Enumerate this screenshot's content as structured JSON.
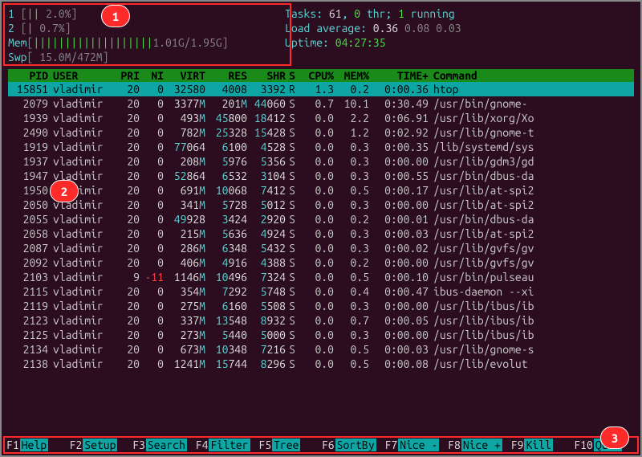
{
  "annotations": {
    "b1": "1",
    "b2": "2",
    "b3": "3"
  },
  "meters": {
    "cpu1": {
      "label": "1",
      "bar": "||",
      "pct": "2.0%"
    },
    "cpu2": {
      "label": "2",
      "bar": "|",
      "pct": "0.7%"
    },
    "mem": {
      "label": "Mem",
      "bar": "|||||||||||||||||||",
      "val": "1.01G/1.95G"
    },
    "swp": {
      "label": "Swp",
      "bar": "",
      "val": "15.0M/472M"
    }
  },
  "summary": {
    "tasks_lbl": "Tasks: ",
    "tasks": "61",
    "tasks_sep": ", ",
    "thr": "0",
    "thr_lbl": " thr; ",
    "running": "1",
    "running_lbl": " running",
    "la_lbl": "Load average: ",
    "la1": "0.36",
    "la2": "0.08",
    "la3": "0.03",
    "up_lbl": "Uptime: ",
    "up": "04:27:35"
  },
  "cols": {
    "pid": "PID",
    "user": "USER",
    "pri": "PRI",
    "ni": "NI",
    "virt": "VIRT",
    "res": "RES",
    "shr": "SHR",
    "s": "S",
    "cpu": "CPU%",
    "mem": "MEM%",
    "time": "TIME+",
    "cmd": "Command"
  },
  "rows": [
    {
      "pid": "15851",
      "user": "vladimir",
      "pri": "20",
      "ni": "0",
      "virt": "32580",
      "res": "4008",
      "shr": "3392",
      "s": "R",
      "cpu": "1.3",
      "mem": "0.2",
      "time": "0:00.36",
      "cmd": "htop",
      "sel": true
    },
    {
      "pid": "2079",
      "user": "vladimir",
      "pri": "20",
      "ni": "0",
      "virt": "3377M",
      "res": "201M",
      "shr": "44060",
      "s": "S",
      "cpu": "0.7",
      "mem": "10.1",
      "time": "0:30.49",
      "cmd": "/usr/bin/gnome-"
    },
    {
      "pid": "1939",
      "user": "vladimir",
      "pri": "20",
      "ni": "0",
      "virt": "493M",
      "res": "45800",
      "shr": "18412",
      "s": "S",
      "cpu": "0.0",
      "mem": "2.2",
      "time": "0:06.91",
      "cmd": "/usr/lib/xorg/Xo"
    },
    {
      "pid": "2490",
      "user": "vladimir",
      "pri": "20",
      "ni": "0",
      "virt": "782M",
      "res": "25328",
      "shr": "15428",
      "s": "S",
      "cpu": "0.0",
      "mem": "1.2",
      "time": "0:02.92",
      "cmd": "/usr/lib/gnome-t"
    },
    {
      "pid": "1919",
      "user": "vladimir",
      "pri": "20",
      "ni": "0",
      "virt": "77064",
      "res": "6100",
      "shr": "4528",
      "s": "S",
      "cpu": "0.0",
      "mem": "0.3",
      "time": "0:00.35",
      "cmd": "/lib/systemd/sys"
    },
    {
      "pid": "1937",
      "user": "vladimir",
      "pri": "20",
      "ni": "0",
      "virt": "208M",
      "res": "5976",
      "shr": "5356",
      "s": "S",
      "cpu": "0.0",
      "mem": "0.3",
      "time": "0:00.00",
      "cmd": "/usr/lib/gdm3/gd"
    },
    {
      "pid": "1947",
      "user": "vladimir",
      "pri": "20",
      "ni": "0",
      "virt": "52864",
      "res": "6532",
      "shr": "3104",
      "s": "S",
      "cpu": "0.0",
      "mem": "0.3",
      "time": "0:00.55",
      "cmd": "/usr/bin/dbus-da"
    },
    {
      "pid": "1950",
      "user": "vladimir",
      "pri": "20",
      "ni": "0",
      "virt": "691M",
      "res": "10068",
      "shr": "7412",
      "s": "S",
      "cpu": "0.0",
      "mem": "0.5",
      "time": "0:00.17",
      "cmd": "/usr/lib/at-spi2"
    },
    {
      "pid": "2050",
      "user": "vladimir",
      "pri": "20",
      "ni": "0",
      "virt": "341M",
      "res": "5728",
      "shr": "5012",
      "s": "S",
      "cpu": "0.0",
      "mem": "0.3",
      "time": "0:00.00",
      "cmd": "/usr/lib/at-spi2"
    },
    {
      "pid": "2055",
      "user": "vladimir",
      "pri": "20",
      "ni": "0",
      "virt": "49928",
      "res": "3424",
      "shr": "2920",
      "s": "S",
      "cpu": "0.0",
      "mem": "0.2",
      "time": "0:00.01",
      "cmd": "/usr/bin/dbus-da"
    },
    {
      "pid": "2058",
      "user": "vladimir",
      "pri": "20",
      "ni": "0",
      "virt": "215M",
      "res": "5636",
      "shr": "4924",
      "s": "S",
      "cpu": "0.0",
      "mem": "0.3",
      "time": "0:00.03",
      "cmd": "/usr/lib/at-spi2"
    },
    {
      "pid": "2087",
      "user": "vladimir",
      "pri": "20",
      "ni": "0",
      "virt": "286M",
      "res": "6348",
      "shr": "5432",
      "s": "S",
      "cpu": "0.0",
      "mem": "0.3",
      "time": "0:00.02",
      "cmd": "/usr/lib/gvfs/gv"
    },
    {
      "pid": "2092",
      "user": "vladimir",
      "pri": "20",
      "ni": "0",
      "virt": "406M",
      "res": "4916",
      "shr": "4388",
      "s": "S",
      "cpu": "0.0",
      "mem": "0.2",
      "time": "0:00.00",
      "cmd": "/usr/lib/gvfs/gv"
    },
    {
      "pid": "2103",
      "user": "vladimir",
      "pri": "9",
      "ni": "-11",
      "virt": "1146M",
      "res": "10496",
      "shr": "7324",
      "s": "S",
      "cpu": "0.0",
      "mem": "0.5",
      "time": "0:00.10",
      "cmd": "/usr/bin/pulseau",
      "nired": true
    },
    {
      "pid": "2115",
      "user": "vladimir",
      "pri": "20",
      "ni": "0",
      "virt": "354M",
      "res": "7292",
      "shr": "5748",
      "s": "S",
      "cpu": "0.0",
      "mem": "0.4",
      "time": "0:00.47",
      "cmd": "ibus-daemon --xi"
    },
    {
      "pid": "2119",
      "user": "vladimir",
      "pri": "20",
      "ni": "0",
      "virt": "275M",
      "res": "6160",
      "shr": "5508",
      "s": "S",
      "cpu": "0.0",
      "mem": "0.3",
      "time": "0:00.00",
      "cmd": "/usr/lib/ibus/ib"
    },
    {
      "pid": "2123",
      "user": "vladimir",
      "pri": "20",
      "ni": "0",
      "virt": "337M",
      "res": "13548",
      "shr": "8932",
      "s": "S",
      "cpu": "0.0",
      "mem": "0.7",
      "time": "0:00.05",
      "cmd": "/usr/lib/ibus/ib"
    },
    {
      "pid": "2125",
      "user": "vladimir",
      "pri": "20",
      "ni": "0",
      "virt": "273M",
      "res": "5440",
      "shr": "5000",
      "s": "S",
      "cpu": "0.0",
      "mem": "0.3",
      "time": "0:00.00",
      "cmd": "/usr/lib/ibus/ib"
    },
    {
      "pid": "2134",
      "user": "vladimir",
      "pri": "20",
      "ni": "0",
      "virt": "673M",
      "res": "10348",
      "shr": "7216",
      "s": "S",
      "cpu": "0.0",
      "mem": "0.5",
      "time": "0:00.03",
      "cmd": "/usr/lib/gnome-s"
    },
    {
      "pid": "2138",
      "user": "vladimir",
      "pri": "20",
      "ni": "0",
      "virt": "1241M",
      "res": "15744",
      "shr": "8296",
      "s": "S",
      "cpu": "0.0",
      "mem": "0.5",
      "time": "0:00.08",
      "cmd": "/usr/lib/evolut"
    }
  ],
  "footer": [
    {
      "k": "F1",
      "l": "Help  "
    },
    {
      "k": "F2",
      "l": "Setup "
    },
    {
      "k": "F3",
      "l": "Search"
    },
    {
      "k": "F4",
      "l": "Filter"
    },
    {
      "k": "F5",
      "l": "Tree  "
    },
    {
      "k": "F6",
      "l": "SortBy"
    },
    {
      "k": "F7",
      "l": "Nice -"
    },
    {
      "k": "F8",
      "l": "Nice +"
    },
    {
      "k": "F9",
      "l": "Kill  "
    },
    {
      "k": "F10",
      "l": "Quit "
    }
  ]
}
